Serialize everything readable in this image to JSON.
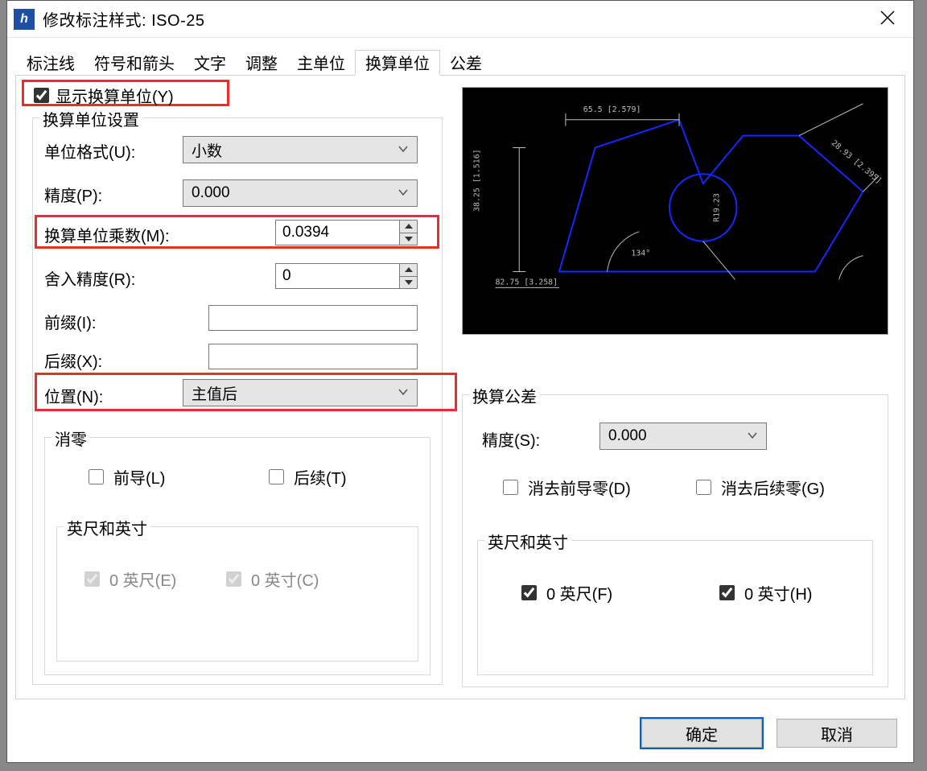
{
  "window": {
    "title": "修改标注样式: ISO-25"
  },
  "tabs": [
    "标注线",
    "符号和箭头",
    "文字",
    "调整",
    "主单位",
    "换算单位",
    "公差"
  ],
  "active_tab": "换算单位",
  "checkbox_show": "显示换算单位(Y)",
  "group_settings": "换算单位设置",
  "settings": {
    "unit_format_lbl": "单位格式(U):",
    "unit_format_val": "小数",
    "precision_lbl": "精度(P):",
    "precision_val": "0.000",
    "multiplier_lbl": "换算单位乘数(M):",
    "multiplier_val": "0.0394",
    "round_lbl": "舍入精度(R):",
    "round_val": "0",
    "prefix_lbl": "前缀(I):",
    "prefix_val": "",
    "suffix_lbl": "后缀(X):",
    "suffix_val": "",
    "placement_lbl": "位置(N):",
    "placement_val": "主值后"
  },
  "group_zero": "消零",
  "zero": {
    "leading": "前导(L)",
    "trailing": "后续(T)",
    "feet_inch_title": "英尺和英寸",
    "zero_feet": "0 英尺(E)",
    "zero_inch": "0 英寸(C)"
  },
  "group_tol": "换算公差",
  "tol": {
    "precision_lbl": "精度(S):",
    "precision_val": "0.000",
    "suppress_leading": "消去前导零(D)",
    "suppress_trailing": "消去后续零(G)",
    "feet_inch_title": "英尺和英寸",
    "zero_feet": "0 英尺(F)",
    "zero_inch": "0 英寸(H)"
  },
  "preview_dims": {
    "top": "65.5 [2.579]",
    "left": "38.25 [1.516]",
    "bottomleft": "82.75 [3.258]",
    "radius": "R19.23",
    "diag": "28.93 [2.395]",
    "angle": "134°"
  },
  "buttons": {
    "ok": "确定",
    "cancel": "取消"
  }
}
